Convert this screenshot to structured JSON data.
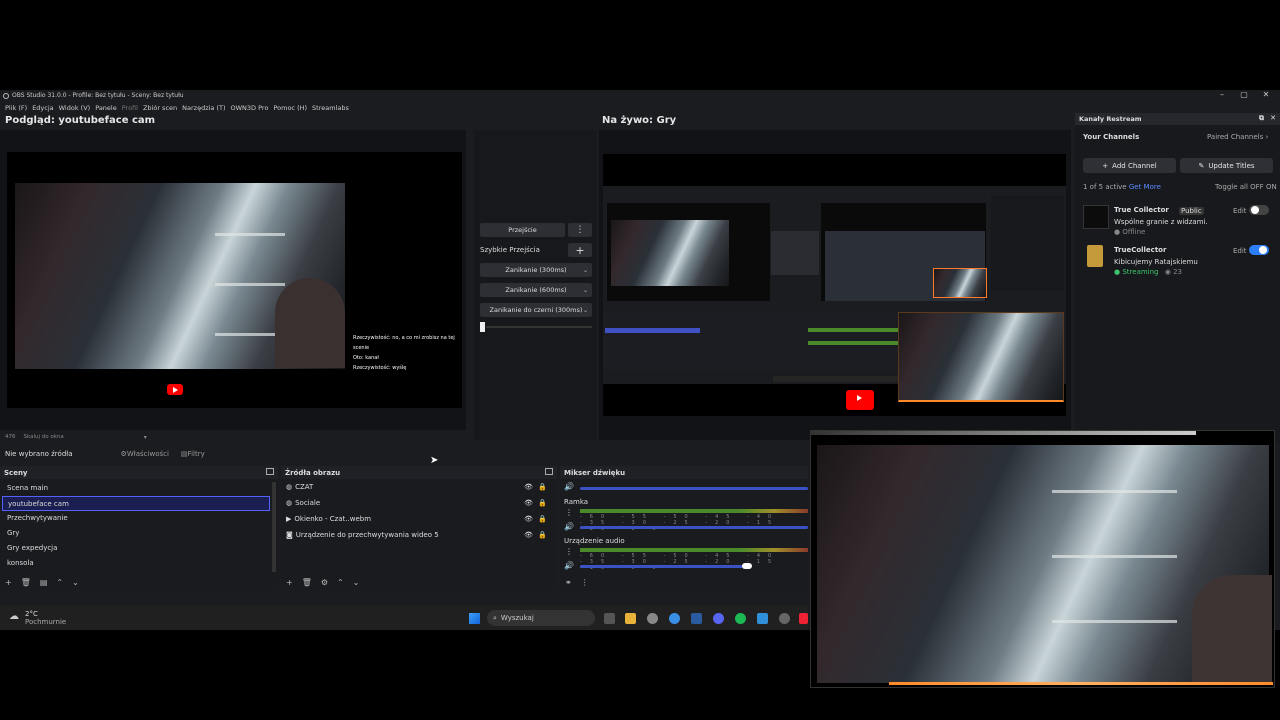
{
  "window": {
    "title": "OBS Studio 31.0.0 - Profile: Bez tytułu - Sceny: Bez tytułu",
    "controls": {
      "minimize": "–",
      "maximize": "▢",
      "close": "✕"
    }
  },
  "menu": [
    "Plik (F)",
    "Edycja",
    "Widok (V)",
    "Panele",
    "Profil",
    "Zbiór scen",
    "Narzędzia (T)",
    "OWN3D Pro",
    "Pomoc (H)",
    "Streamlabs"
  ],
  "preview": {
    "title": "Podgląd: youtubeface cam",
    "chat_lines": [
      "Rzeczywistość: no, a co mi zrobisz na tej scenie",
      "Oto: kanał",
      "Rzeczywistość: wyślę"
    ],
    "status_left": "476",
    "status_scale": "Skaluj do okna"
  },
  "transitions": {
    "main_button": "Przejście",
    "quick_label": "Szybkie Przejścia",
    "items": [
      "Zanikanie (300ms)",
      "Zanikanie (600ms)",
      "Zanikanie do czerni (300ms)"
    ]
  },
  "live": {
    "title": "Na żywo: Gry"
  },
  "restream": {
    "header": "Kanały Restream",
    "tab_channels": "Your Channels",
    "tab_paired": "Paired Channels",
    "add_channel": "Add Channel",
    "update_titles": "Update Titles",
    "active_count": "1 of 5 active",
    "get_more": "Get More",
    "toggle_all": "Toggle all OFF",
    "toggle_all_on": "ON",
    "edit_label": "Edit",
    "channels": [
      {
        "name": "True Collector",
        "badge": "Public",
        "title": "Wspólne granie z widzami.",
        "status": "Offline",
        "enabled": false
      },
      {
        "name": "TrueCollector",
        "badge": "",
        "title": "Kibicujemy Ratajskiemu",
        "status": "Streaming",
        "viewers": "23",
        "enabled": true
      }
    ]
  },
  "source_bar": {
    "no_source": "Nie wybrano źródła",
    "properties": "Właściwości",
    "filters": "Filtry"
  },
  "scenes": {
    "title": "Sceny",
    "items": [
      "Scena main",
      "youtubeface cam",
      "Przechwytywanie",
      "Gry",
      "Gry expedycja",
      "konsola"
    ],
    "selected_index": 1
  },
  "sources": {
    "title": "Źródła obrazu",
    "items": [
      "CZAT",
      "Sociale",
      "Okienko - Czat..webm",
      "Urządzenie do przechwytywania wideo 5"
    ]
  },
  "mixer": {
    "title": "Mikser dźwięku",
    "channels": [
      "Ramka",
      "Urządzenie audio"
    ],
    "ticks": "-60 -55 -50 -45 -40 -35 -30 -25 -20 -15 -10 -5 0"
  },
  "taskbar": {
    "weather_temp": "2°C",
    "weather_desc": "Pochmurnie",
    "search_placeholder": "Wyszukaj"
  },
  "colors": {
    "accent": "#5561ff",
    "restream_toggle": "#2d7ff9",
    "youtube": "#ff0000"
  }
}
